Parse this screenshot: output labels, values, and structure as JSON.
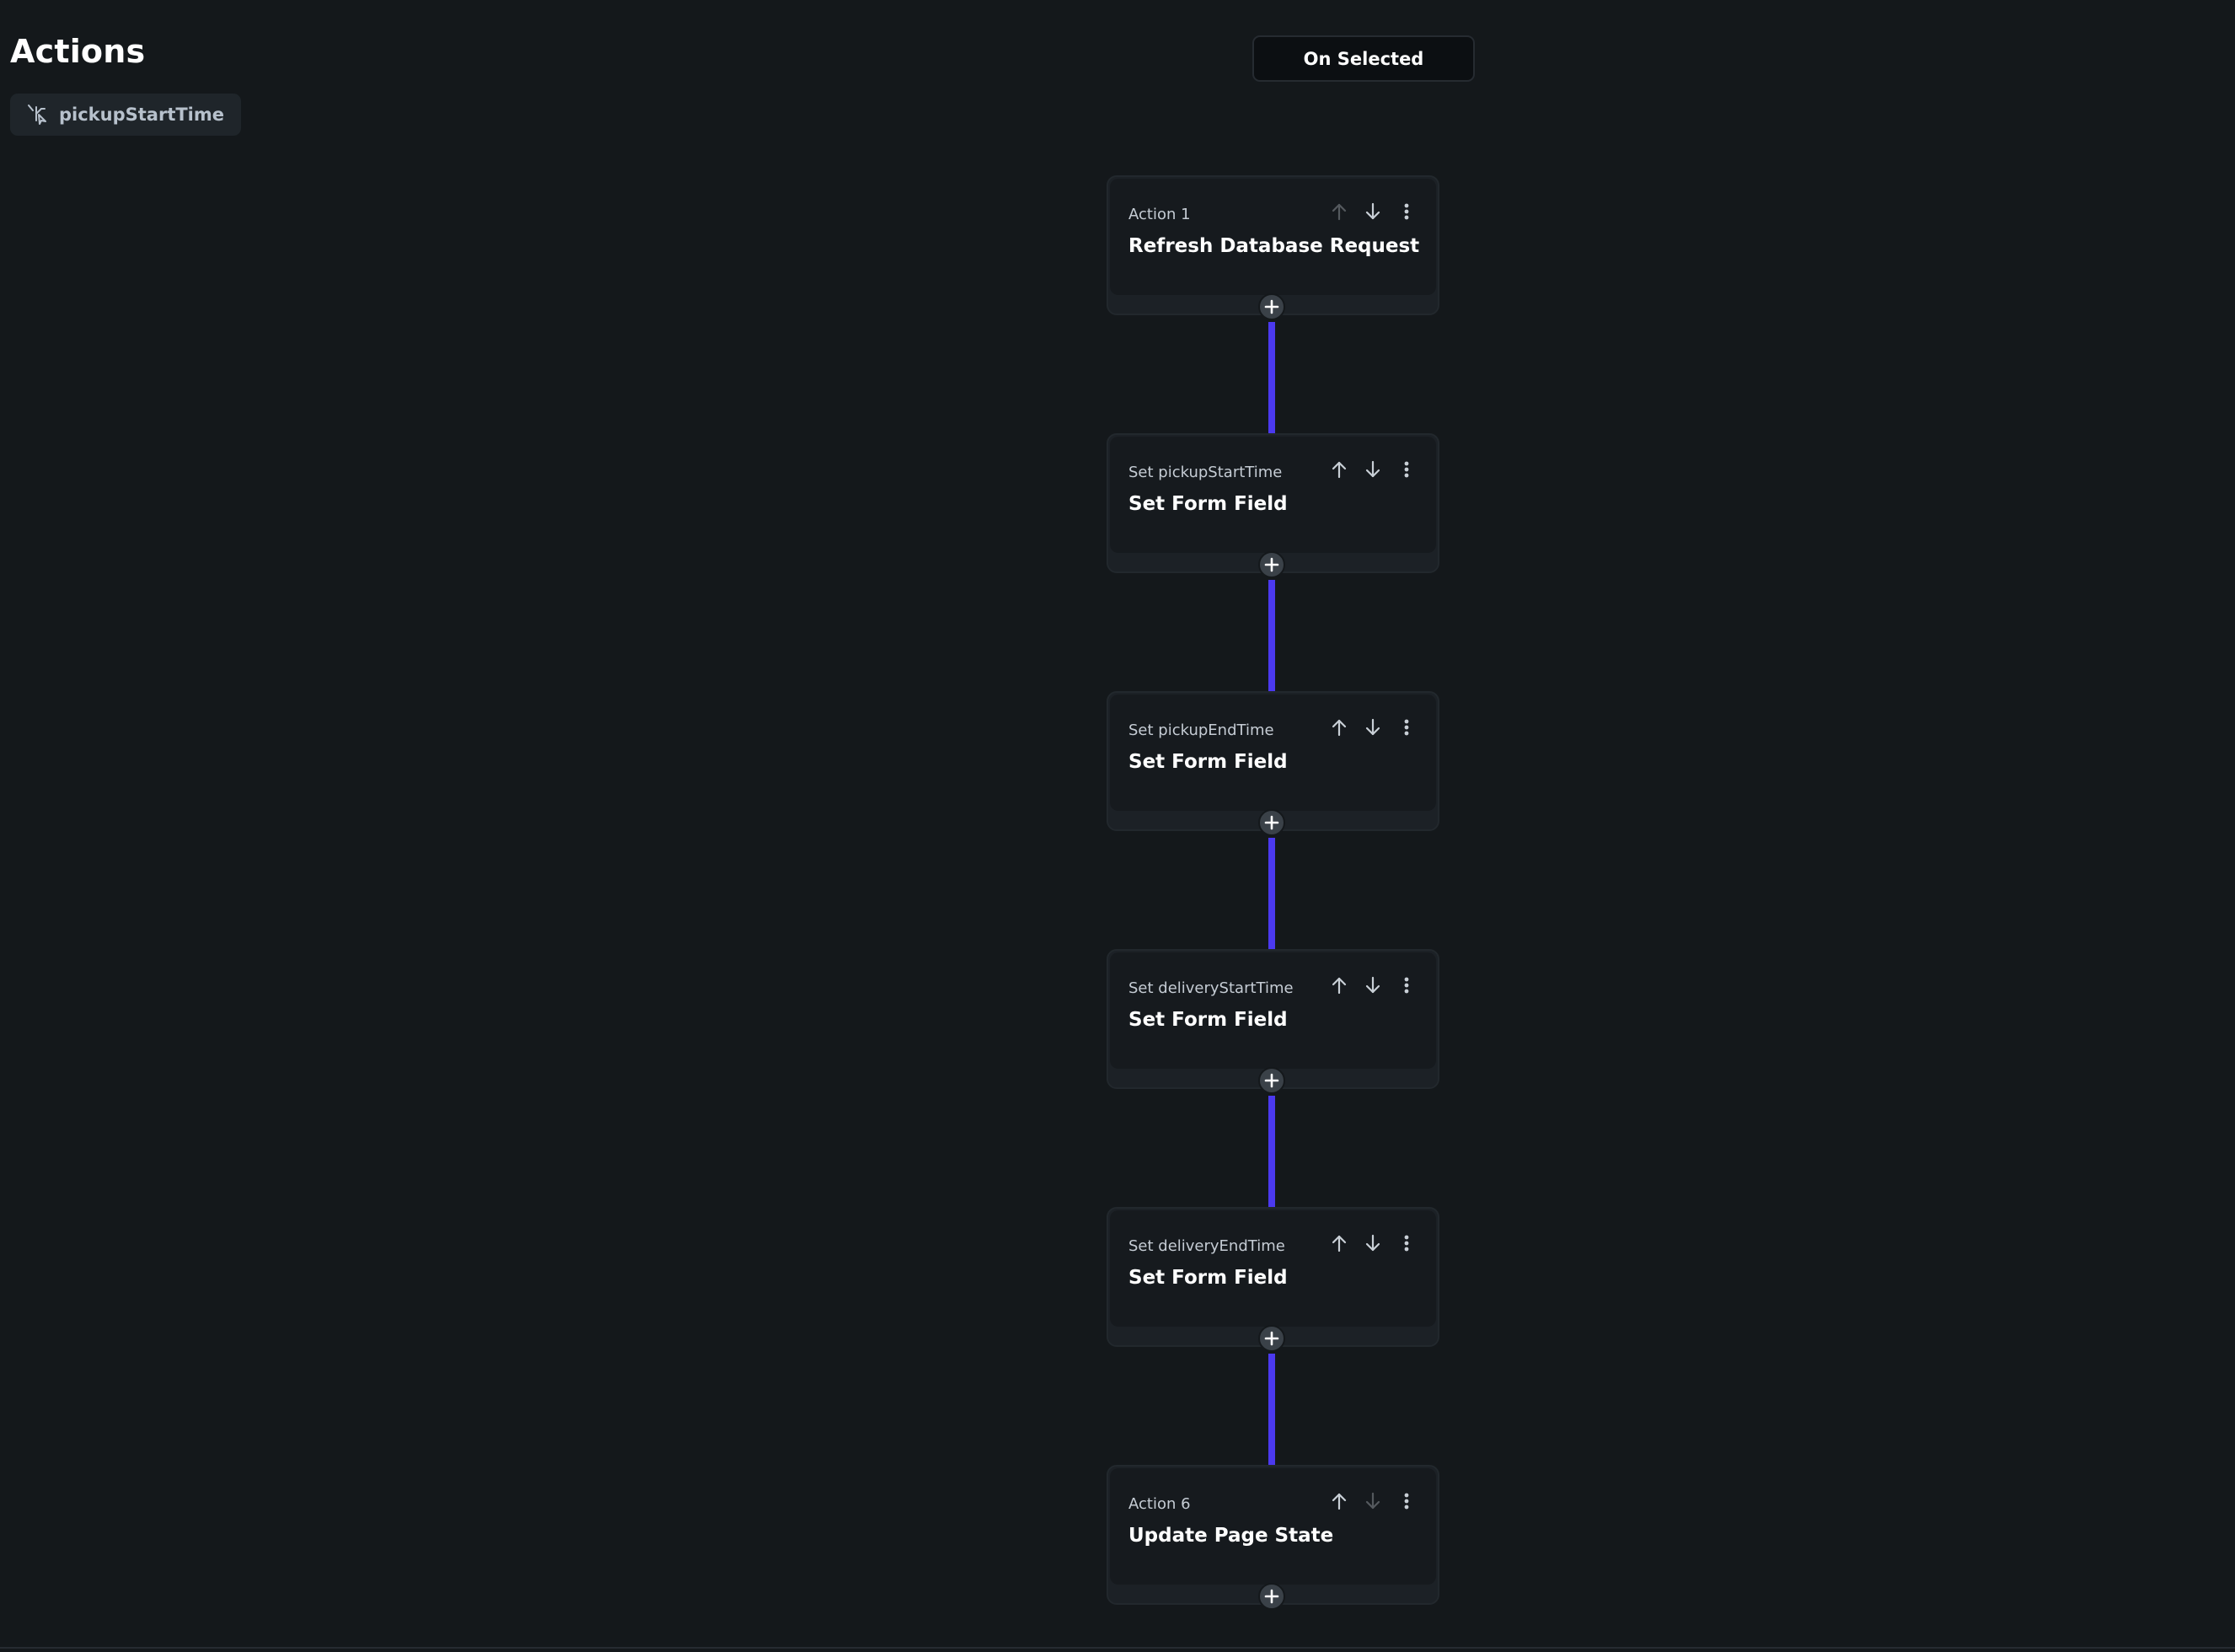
{
  "header": {
    "title": "Actions",
    "widget_chip_label": "pickupStartTime",
    "trigger_label": "On Selected"
  },
  "colors": {
    "background": "#14181b",
    "card": "#161a1e",
    "connector": "#4b39ef"
  },
  "actions": [
    {
      "label": "Action 1",
      "title": "Refresh Database Request",
      "up_enabled": false,
      "down_enabled": true
    },
    {
      "label": "Set pickupStartTime",
      "title": "Set Form Field",
      "up_enabled": true,
      "down_enabled": true
    },
    {
      "label": "Set pickupEndTime",
      "title": "Set Form Field",
      "up_enabled": true,
      "down_enabled": true
    },
    {
      "label": "Set deliveryStartTime",
      "title": "Set Form Field",
      "up_enabled": true,
      "down_enabled": true
    },
    {
      "label": "Set deliveryEndTime",
      "title": "Set Form Field",
      "up_enabled": true,
      "down_enabled": true
    },
    {
      "label": "Action 6",
      "title": "Update Page State",
      "up_enabled": true,
      "down_enabled": false
    }
  ],
  "icons": {
    "chip": "widget-tree-icon",
    "move_up": "arrow-up-icon",
    "move_down": "arrow-down-icon",
    "more": "more-vertical-icon",
    "add": "plus-icon"
  }
}
